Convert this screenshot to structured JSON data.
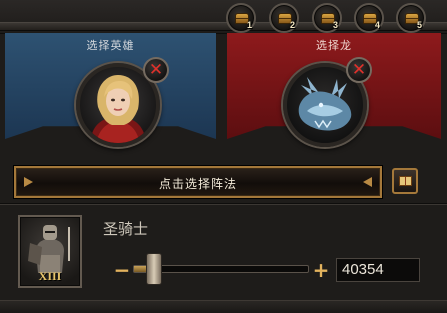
{
  "formation_slots": [
    {
      "number": "1",
      "icon": "chest-icon"
    },
    {
      "number": "2",
      "icon": "chest-icon"
    },
    {
      "number": "3",
      "icon": "chest-icon"
    },
    {
      "number": "4",
      "icon": "chest-icon"
    },
    {
      "number": "5",
      "icon": "chest-icon"
    }
  ],
  "hero_panel": {
    "title": "选择英雄",
    "color": "#2e5272"
  },
  "dragon_panel": {
    "title": "选择龙",
    "color": "#8e1a1c"
  },
  "formation_bar": {
    "label": "点击选择阵法"
  },
  "troop": {
    "name": "圣骑士",
    "tier": "XIII",
    "count": "40354",
    "slider_fraction": 0.12
  }
}
